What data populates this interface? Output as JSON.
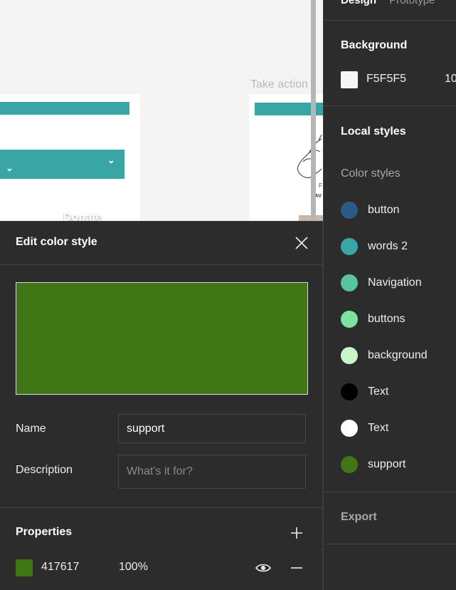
{
  "canvas": {
    "frame_label": "Take action",
    "donate_label": "Donate",
    "chevron": "⌄",
    "illustration_green_text": "F",
    "illustration_small_text": "SAV",
    "colors": {
      "teal": "#3aa5a5"
    }
  },
  "design_panel": {
    "tabs": [
      "Design",
      "Prototype"
    ],
    "background": {
      "title": "Background",
      "hex": "F5F5F5",
      "opacity": "10",
      "color": "#F5F5F5"
    },
    "local_styles_title": "Local styles",
    "color_styles_title": "Color styles",
    "color_styles": [
      {
        "name": "button",
        "color": "#2a5b84"
      },
      {
        "name": "words 2",
        "color": "#3aa5a5"
      },
      {
        "name": "Navigation",
        "color": "#56c69c"
      },
      {
        "name": "buttons",
        "color": "#7be39b"
      },
      {
        "name": "background",
        "color": "#c8f5cc"
      },
      {
        "name": "Text",
        "color": "#000000"
      },
      {
        "name": "Text",
        "color": "#ffffff"
      },
      {
        "name": "support",
        "color": "#417617"
      }
    ],
    "export_title": "Export"
  },
  "modal": {
    "title": "Edit color style",
    "preview_color": "#417617",
    "name_label": "Name",
    "name_value": "support",
    "description_label": "Description",
    "description_placeholder": "What's it for?",
    "properties_title": "Properties",
    "property": {
      "hex": "417617",
      "opacity": "100%",
      "color": "#417617"
    },
    "icons": [
      "close-icon",
      "plus-icon",
      "eye-icon",
      "minus-icon"
    ]
  }
}
